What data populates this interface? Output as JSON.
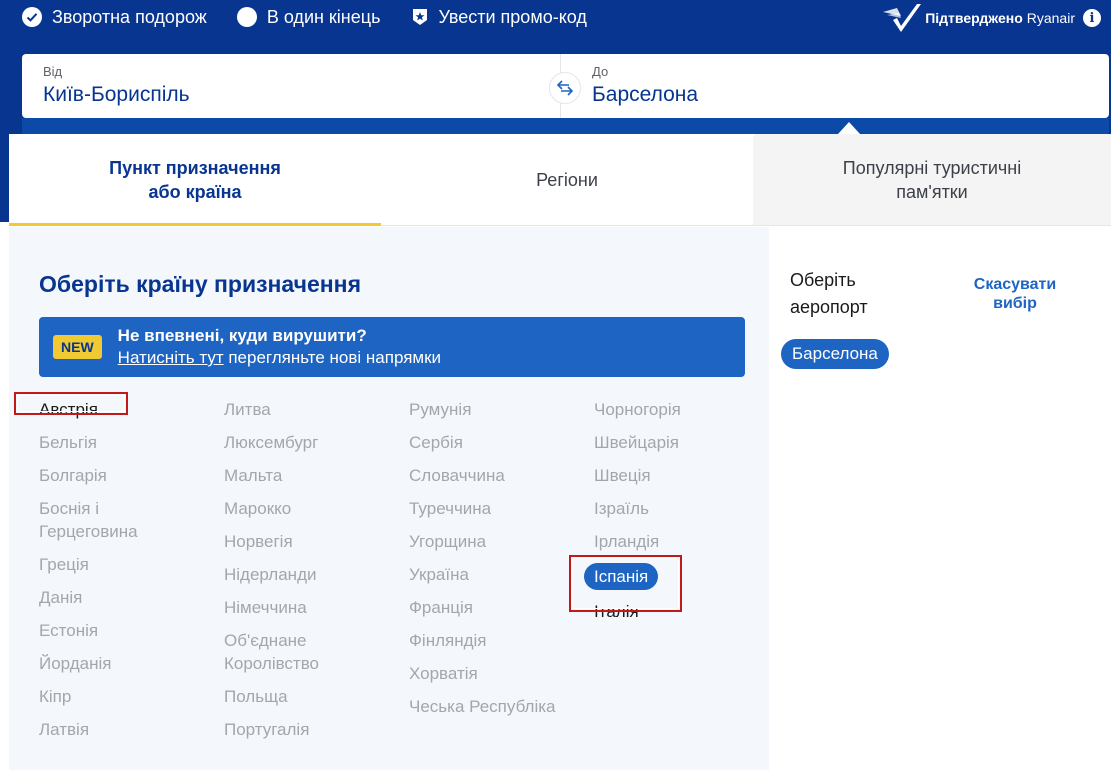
{
  "trip_options": {
    "return_label": "Зворотна подорож",
    "oneway_label": "В один кінець",
    "promo_label": "Увести промо-код"
  },
  "verified": {
    "bold": "Підтверджено",
    "brand": "Ryanair",
    "info": "i"
  },
  "route": {
    "from_label": "Від",
    "from_value": "Київ-Бориспіль",
    "to_label": "До",
    "to_value": "Барселона"
  },
  "tabs": [
    {
      "label": "Пункт призначення або країна"
    },
    {
      "label": "Регіони"
    },
    {
      "label": "Популярні туристичні пам'ятки"
    }
  ],
  "destination": {
    "heading": "Оберіть країну призначення",
    "banner": {
      "badge": "NEW",
      "title": "Не впевнені, куди вирушити?",
      "link": "Натисніть тут",
      "rest": " перегляньте нові напрямки"
    }
  },
  "countries": {
    "col1": [
      "Австрія",
      "Бельгія",
      "Болгарія",
      "Боснія і Герцеговина",
      "Греція",
      "Данія",
      "Естонія",
      "Йорданія",
      "Кіпр",
      "Латвія"
    ],
    "col2": [
      "Литва",
      "Люксембург",
      "Мальта",
      "Марокко",
      "Норвегія",
      "Нідерланди",
      "Німеччина",
      "Об'єднане Королівство",
      "Польща",
      "Португалія"
    ],
    "col3": [
      "Румунія",
      "Сербія",
      "Словаччина",
      "Туреччина",
      "Угорщина",
      "Україна",
      "Франція",
      "Фінляндія",
      "Хорватія",
      "Чеська Республіка"
    ],
    "col4": [
      "Чорногорія",
      "Швейцарія",
      "Швеція",
      "Ізраїль",
      "Ірландія",
      "Іспанія",
      "Італія"
    ]
  },
  "airport": {
    "title": "Оберіть аеропорт",
    "cancel": "Скасувати вибір",
    "selected": "Барселона"
  },
  "colors": {
    "brand_blue": "#073590",
    "accent_blue": "#1d64c3",
    "yellow": "#f1c933"
  }
}
